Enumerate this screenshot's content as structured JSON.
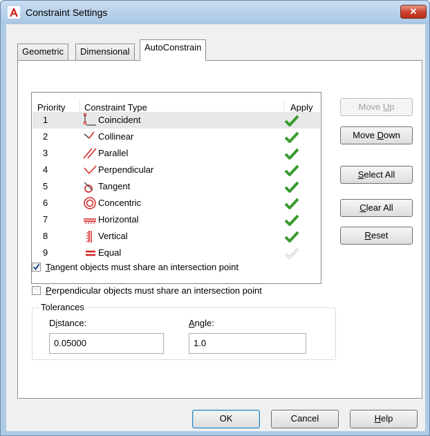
{
  "window": {
    "title": "Constraint Settings",
    "close_label": "✕",
    "accent": "#aecbe6"
  },
  "tabs": [
    {
      "label": "Geometric",
      "active": false
    },
    {
      "label": "Dimensional",
      "active": false
    },
    {
      "label": "AutoConstrain",
      "active": true
    }
  ],
  "list": {
    "headers": {
      "priority": "Priority",
      "type": "Constraint Type",
      "apply": "Apply"
    },
    "rows": [
      {
        "priority": "1",
        "name": "Coincident",
        "icon": "coincident-icon",
        "apply": true
      },
      {
        "priority": "2",
        "name": "Collinear",
        "icon": "collinear-icon",
        "apply": true
      },
      {
        "priority": "3",
        "name": "Parallel",
        "icon": "parallel-icon",
        "apply": true
      },
      {
        "priority": "4",
        "name": "Perpendicular",
        "icon": "perpendicular-icon",
        "apply": true
      },
      {
        "priority": "5",
        "name": "Tangent",
        "icon": "tangent-icon",
        "apply": true
      },
      {
        "priority": "6",
        "name": "Concentric",
        "icon": "concentric-icon",
        "apply": true
      },
      {
        "priority": "7",
        "name": "Horizontal",
        "icon": "horizontal-icon",
        "apply": true
      },
      {
        "priority": "8",
        "name": "Vertical",
        "icon": "vertical-icon",
        "apply": true
      },
      {
        "priority": "9",
        "name": "Equal",
        "icon": "equal-icon",
        "apply": false
      }
    ]
  },
  "buttons": {
    "move_up": {
      "pre": "Move ",
      "ul": "U",
      "post": "p"
    },
    "move_down": {
      "pre": "Move ",
      "ul": "D",
      "post": "own"
    },
    "select_all": {
      "pre": "",
      "ul": "S",
      "post": "elect All"
    },
    "clear_all": {
      "pre": "",
      "ul": "C",
      "post": "lear All"
    },
    "reset": {
      "pre": "",
      "ul": "R",
      "post": "eset"
    },
    "ok": {
      "label": "OK"
    },
    "cancel": {
      "label": "Cancel"
    },
    "help": {
      "pre": "",
      "ul": "H",
      "post": "elp"
    }
  },
  "options": {
    "tangent": {
      "pre": "",
      "ul": "T",
      "post": "angent objects must share an intersection point",
      "checked": true
    },
    "perpendicular": {
      "pre": "",
      "ul": "P",
      "post": "erpendicular objects must share an intersection point",
      "checked": false
    }
  },
  "tolerances": {
    "legend": "Tolerances",
    "distance_label_pre": "D",
    "distance_label_ul": "i",
    "distance_label_post": "stance:",
    "distance_value": "0.05000",
    "angle_label_pre": "",
    "angle_label_ul": "A",
    "angle_label_post": "ngle:",
    "angle_value": "1.0"
  },
  "colors": {
    "check_green": "#3a9a2f",
    "check_disabled": "#c8c8c8",
    "icon_red": "#d42020"
  }
}
